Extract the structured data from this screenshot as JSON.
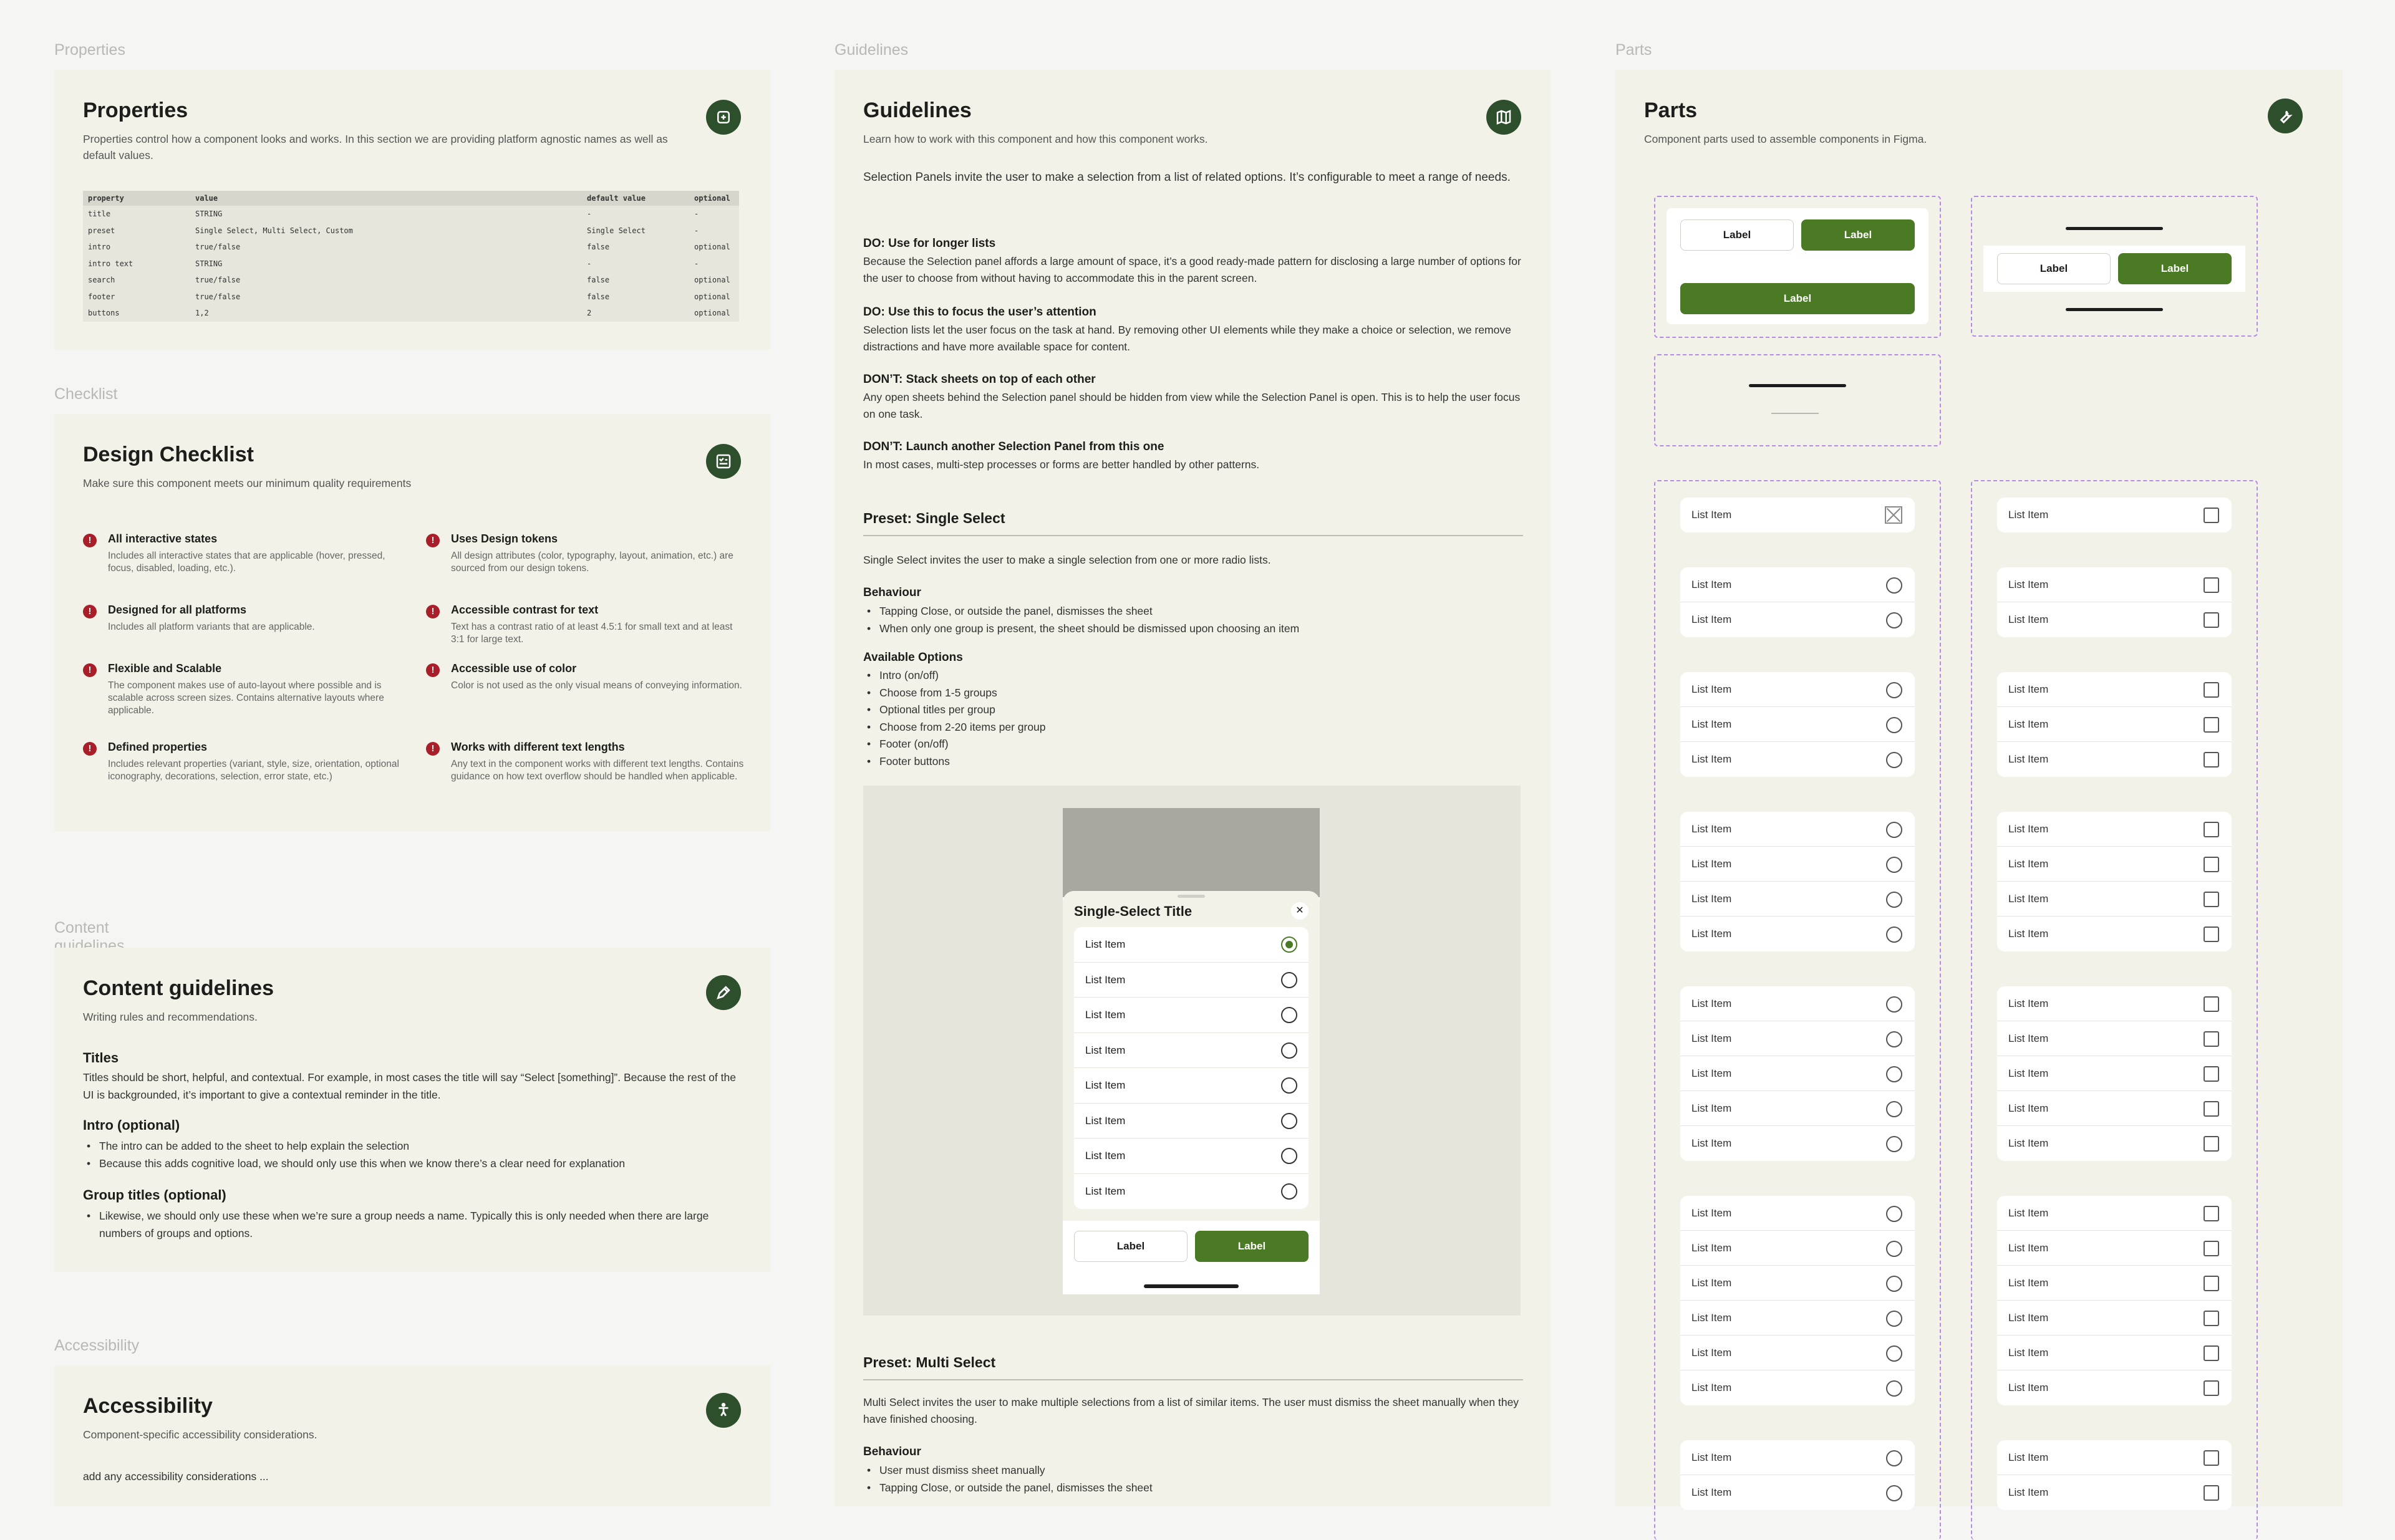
{
  "sections": {
    "properties": "Properties",
    "checklist": "Checklist",
    "content": "Content guidelines",
    "accessibility": "Accessibility",
    "guidelines": "Guidelines",
    "parts": "Parts"
  },
  "properties": {
    "title": "Properties",
    "desc": "Properties control how a component looks and works. In this section we are providing platform agnostic names as well as default values.",
    "icon": "component-icon",
    "headers": [
      "property",
      "value",
      "default value",
      "optional"
    ],
    "rows": [
      [
        "title",
        "STRING",
        "-",
        "-"
      ],
      [
        "preset",
        "Single Select, Multi Select, Custom",
        "Single Select",
        "-"
      ],
      [
        "intro",
        "true/false",
        "false",
        "optional"
      ],
      [
        "intro text",
        "STRING",
        "-",
        "-"
      ],
      [
        "search",
        "true/false",
        "false",
        "optional"
      ],
      [
        "footer",
        "true/false",
        "false",
        "optional"
      ],
      [
        "buttons",
        "1,2",
        "2",
        "optional"
      ]
    ]
  },
  "checklist": {
    "title": "Design Checklist",
    "desc": "Make sure this component meets our minimum quality requirements",
    "icon": "checklist-icon",
    "items": [
      {
        "title": "All interactive states",
        "desc": "Includes all interactive states that are applicable (hover, pressed, focus, disabled, loading, etc.)."
      },
      {
        "title": "Uses Design tokens",
        "desc": "All design attributes (color, typography, layout, animation, etc.) are sourced from our design tokens."
      },
      {
        "title": "Designed for all platforms",
        "desc": "Includes all platform variants that are applicable."
      },
      {
        "title": "Accessible contrast for text",
        "desc": "Text has a contrast ratio of at least 4.5:1 for small text and at least 3:1 for large text."
      },
      {
        "title": "Flexible and Scalable",
        "desc": "The component makes use of auto-layout where possible and is scalable across screen sizes. Contains alternative layouts where applicable."
      },
      {
        "title": "Accessible use of color",
        "desc": "Color is not used as the only visual means of conveying information."
      },
      {
        "title": "Defined properties",
        "desc": "Includes relevant properties (variant, style, size, orientation, optional iconography, decorations, selection, error state, etc.)"
      },
      {
        "title": "Works with different text lengths",
        "desc": "Any text in the component works with different text lengths. Contains guidance on how text overflow should be handled when applicable."
      }
    ]
  },
  "content": {
    "title": "Content guidelines",
    "desc": "Writing rules and recommendations.",
    "icon": "pen-icon",
    "titles_h": "Titles",
    "titles_p": "Titles should be short, helpful, and contextual. For example, in most cases the title will say “Select [something]”. Because the rest of the UI is backgrounded, it’s important to give a contextual reminder in the title.",
    "intro_h": "Intro (optional)",
    "intro_b1": "The intro can be added to the sheet to help explain the selection",
    "intro_b2": "Because this adds cognitive load, we should only use this when we know there’s a clear need for explanation",
    "group_h": "Group titles (optional)",
    "group_b1": "Likewise, we should only use these when we’re sure a group needs a name. Typically this is only needed when there are large numbers of groups and options."
  },
  "accessibility": {
    "title": "Accessibility",
    "desc": "Component-specific accessibility considerations.",
    "icon": "accessibility-icon",
    "body": "add any accessibility considerations ..."
  },
  "guidelines": {
    "title": "Guidelines",
    "desc": "Learn how to work with this component and how this component works.",
    "icon": "map-icon",
    "intro": "Selection Panels invite the user to make a selection from a list of related options. It’s configurable to meet a range of needs.",
    "do1_h": "DO: Use for longer lists",
    "do1_p": "Because the Selection panel affords a large amount of space, it’s a good ready-made pattern for disclosing a large number of options for the user to choose from without having to accommodate this in the parent screen.",
    "do2_h": "DO: Use this to focus the user’s attention",
    "do2_p": "Selection lists let the user focus on the task at hand. By removing other UI elements while they make a choice or selection, we remove distractions and have more available space for content.",
    "dont1_h": "DON’T: Stack sheets on top of each other",
    "dont1_p": "Any open sheets behind the Selection panel should be hidden from view while the Selection Panel is open. This is to help the user focus on one task.",
    "dont2_h": "DON’T: Launch another Selection Panel from this one",
    "dont2_p": "In most cases, multi-step processes or forms are better handled by other patterns.",
    "single_h": "Preset: Single Select",
    "single_p": "Single Select invites the user to make a single selection from one or more radio lists.",
    "beh_h": "Behaviour",
    "beh": [
      "Tapping Close, or outside the panel, dismisses the sheet",
      "When only one group is present, the sheet should be dismissed upon choosing an item"
    ],
    "opt_h": "Available Options",
    "opts": [
      "Intro (on/off)",
      "Choose from 1-5 groups",
      "Optional titles per group",
      "Choose from 2-20 items per group",
      "Footer (on/off)",
      "Footer buttons"
    ],
    "multi_h": "Preset: Multi Select",
    "multi_p": "Multi Select invites the user to make multiple selections from a list of similar items. The user must dismiss the sheet manually when they have finished choosing.",
    "beh2_h": "Behaviour",
    "beh2": [
      "User must dismiss sheet manually",
      "Tapping Close, or outside the panel, dismisses the sheet"
    ]
  },
  "sheet": {
    "title": "Single-Select Title",
    "close": "✕",
    "item": "List Item",
    "items": [
      "List Item",
      "List Item",
      "List Item",
      "List Item",
      "List Item",
      "List Item",
      "List Item",
      "List Item"
    ],
    "selected_index": 0,
    "btn_secondary": "Label",
    "btn_primary": "Label"
  },
  "parts": {
    "title": "Parts",
    "desc": "Component parts used to assemble components in Figma.",
    "icon": "wrench-icon",
    "label": "Label",
    "item": "List Item",
    "left_groups": [
      1,
      2,
      3,
      4,
      5,
      6,
      2
    ],
    "right_groups": [
      1,
      2,
      3,
      4,
      5,
      6,
      2
    ]
  },
  "colors": {
    "accent": "#4a7a23",
    "badge": "#2d4f2c",
    "panel": "#f2f2e8",
    "error": "#a81f2a",
    "dashed": "#b58be8"
  }
}
